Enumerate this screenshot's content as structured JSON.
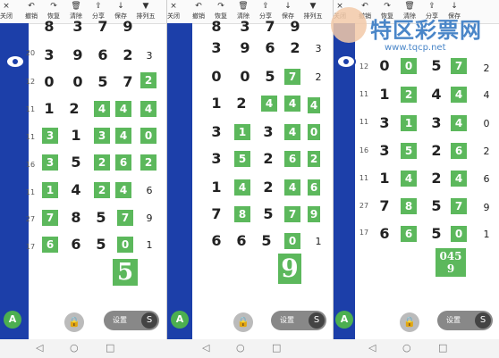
{
  "toolbar_items": [
    {
      "icon": "×",
      "label": "关闭"
    },
    {
      "icon": "↶",
      "label": "撤销"
    },
    {
      "icon": "↷",
      "label": "恢复"
    },
    {
      "icon": "🗑",
      "label": "清除"
    },
    {
      "icon": "⇪",
      "label": "分享"
    },
    {
      "icon": "↓",
      "label": "保存"
    },
    {
      "icon": "▼",
      "label": "排列五"
    }
  ],
  "panel1": {
    "rows": [
      {
        "side": "20",
        "nums": [
          "3",
          "9",
          "6",
          "2"
        ],
        "right": "3"
      },
      {
        "side": "12",
        "nums": [
          "0",
          "0",
          "5",
          "7"
        ],
        "right": "2"
      },
      {
        "side": "11",
        "nums": [
          "1",
          "2",
          "4",
          "4"
        ],
        "right": "4"
      },
      {
        "side": "11",
        "nums": [
          "3",
          "1",
          "3",
          "4"
        ],
        "right": "0"
      },
      {
        "side": "16",
        "nums": [
          "3",
          "5",
          "2",
          "6"
        ],
        "right": "2"
      },
      {
        "side": "11",
        "nums": [
          "1",
          "4",
          "2",
          "4"
        ],
        "right": "6"
      },
      {
        "side": "27",
        "nums": [
          "7",
          "8",
          "5",
          "7"
        ],
        "right": "9"
      },
      {
        "side": "17",
        "nums": [
          "6",
          "6",
          "5",
          "0"
        ],
        "right": "1"
      }
    ],
    "big": "5",
    "top_row": [
      "8",
      "3",
      "7",
      "9"
    ]
  },
  "panel2": {
    "big": "9",
    "top_row": [
      "8",
      "3",
      "7",
      "9"
    ]
  },
  "panel3": {
    "sum": "045",
    "sum2": "9"
  },
  "settings_label": "设置",
  "settings_glyph": "S",
  "lock_glyph": "🔒",
  "app_glyph": "A",
  "nav": {
    "back": "◁",
    "home": "○",
    "recent": "□"
  },
  "watermark": {
    "title": "特区彩票网",
    "url": "www.tqcp.net"
  },
  "colors": {
    "green": "#5cb85c",
    "sidebar": "#1c3fa9"
  }
}
